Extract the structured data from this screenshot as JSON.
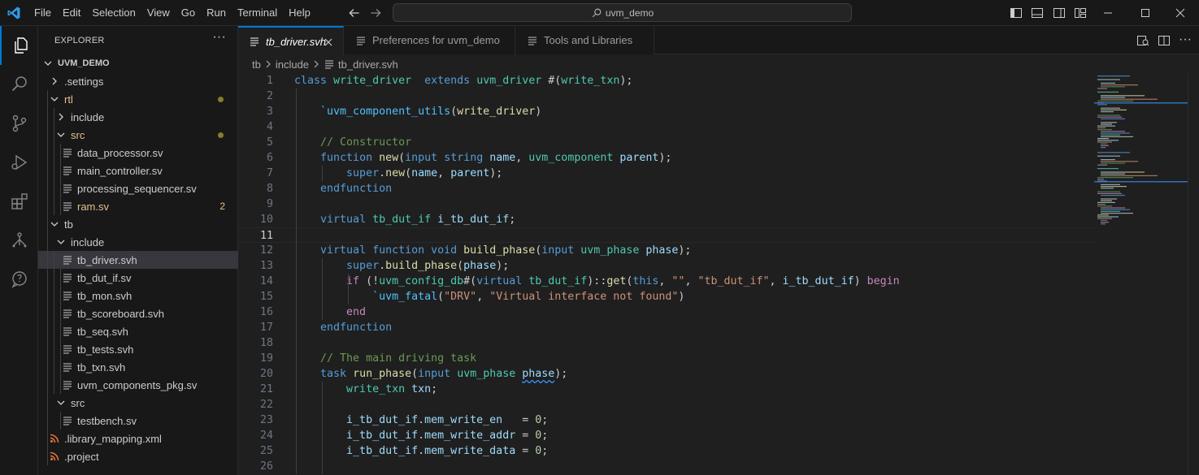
{
  "titlebar": {
    "menu": [
      "File",
      "Edit",
      "Selection",
      "View",
      "Go",
      "Run",
      "Terminal",
      "Help"
    ],
    "command_center": "uvm_demo"
  },
  "sidebar": {
    "header": "EXPLORER",
    "more": "···",
    "root": "UVM_DEMO",
    "items": [
      {
        "label": ".settings",
        "kind": "folder",
        "expanded": false,
        "depth": 1
      },
      {
        "label": "rtl",
        "kind": "folder",
        "expanded": true,
        "depth": 1,
        "modified": true
      },
      {
        "label": "include",
        "kind": "folder",
        "expanded": false,
        "depth": 2
      },
      {
        "label": "src",
        "kind": "folder",
        "expanded": true,
        "depth": 2,
        "modified": true
      },
      {
        "label": "data_processor.sv",
        "kind": "file",
        "depth": 3
      },
      {
        "label": "main_controller.sv",
        "kind": "file",
        "depth": 3
      },
      {
        "label": "processing_sequencer.sv",
        "kind": "file",
        "depth": 3
      },
      {
        "label": "ram.sv",
        "kind": "file",
        "depth": 3,
        "modified": true,
        "badge": "2"
      },
      {
        "label": "tb",
        "kind": "folder",
        "expanded": true,
        "depth": 1
      },
      {
        "label": "include",
        "kind": "folder",
        "expanded": true,
        "depth": 2
      },
      {
        "label": "tb_driver.svh",
        "kind": "file",
        "depth": 3,
        "selected": true
      },
      {
        "label": "tb_dut_if.sv",
        "kind": "file",
        "depth": 3
      },
      {
        "label": "tb_mon.svh",
        "kind": "file",
        "depth": 3
      },
      {
        "label": "tb_scoreboard.svh",
        "kind": "file",
        "depth": 3
      },
      {
        "label": "tb_seq.svh",
        "kind": "file",
        "depth": 3
      },
      {
        "label": "tb_tests.svh",
        "kind": "file",
        "depth": 3
      },
      {
        "label": "tb_txn.svh",
        "kind": "file",
        "depth": 3
      },
      {
        "label": "uvm_components_pkg.sv",
        "kind": "file",
        "depth": 3
      },
      {
        "label": "src",
        "kind": "folder",
        "expanded": true,
        "depth": 2
      },
      {
        "label": "testbench.sv",
        "kind": "file",
        "depth": 3
      },
      {
        "label": ".library_mapping.xml",
        "kind": "rss",
        "depth": 1
      },
      {
        "label": ".project",
        "kind": "rss",
        "depth": 1
      }
    ]
  },
  "tabs": [
    {
      "label": "tb_driver.svh",
      "active": true,
      "icon": "file-lines-icon"
    },
    {
      "label": "Preferences for uvm_demo",
      "active": false,
      "icon": "file-lines-icon"
    },
    {
      "label": "Tools and Libraries",
      "active": false,
      "icon": "file-lines-icon"
    }
  ],
  "breadcrumb": [
    "tb",
    "include",
    "tb_driver.svh"
  ],
  "editor": {
    "current_line": 11,
    "lines": [
      [
        [
          "kw",
          "class "
        ],
        [
          "ty",
          "write_driver"
        ],
        [
          "",
          "  "
        ],
        [
          "kw",
          "extends "
        ],
        [
          "ty",
          "uvm_driver"
        ],
        [
          "",
          " #("
        ],
        [
          "ty",
          "write_txn"
        ],
        [
          "",
          ");"
        ]
      ],
      [],
      [
        [
          "",
          "    "
        ],
        [
          "mac",
          "`uvm_component_utils"
        ],
        [
          "",
          "("
        ],
        [
          "fn",
          "write_driver"
        ],
        [
          "",
          ")"
        ]
      ],
      [],
      [
        [
          "",
          "    "
        ],
        [
          "cm",
          "// Constructor"
        ]
      ],
      [
        [
          "",
          "    "
        ],
        [
          "kw",
          "function "
        ],
        [
          "fn",
          "new"
        ],
        [
          "",
          "("
        ],
        [
          "kw",
          "input "
        ],
        [
          "kw",
          "string "
        ],
        [
          "var",
          "name"
        ],
        [
          "",
          ", "
        ],
        [
          "ty",
          "uvm_component "
        ],
        [
          "var",
          "parent"
        ],
        [
          "",
          ");"
        ]
      ],
      [
        [
          "",
          "        "
        ],
        [
          "kw",
          "super"
        ],
        [
          "",
          "."
        ],
        [
          "fn",
          "new"
        ],
        [
          "",
          "("
        ],
        [
          "var",
          "name"
        ],
        [
          "",
          ", "
        ],
        [
          "var",
          "parent"
        ],
        [
          "",
          ");"
        ]
      ],
      [
        [
          "",
          "    "
        ],
        [
          "kw",
          "endfunction"
        ]
      ],
      [],
      [
        [
          "",
          "    "
        ],
        [
          "kw",
          "virtual "
        ],
        [
          "ty",
          "tb_dut_if "
        ],
        [
          "var",
          "i_tb_dut_if"
        ],
        [
          "",
          ";"
        ]
      ],
      [],
      [
        [
          "",
          "    "
        ],
        [
          "kw",
          "virtual "
        ],
        [
          "kw",
          "function "
        ],
        [
          "kw",
          "void "
        ],
        [
          "fn",
          "build_phase"
        ],
        [
          "",
          "("
        ],
        [
          "kw",
          "input "
        ],
        [
          "ty",
          "uvm_phase "
        ],
        [
          "var",
          "phase"
        ],
        [
          "",
          ");"
        ]
      ],
      [
        [
          "",
          "        "
        ],
        [
          "kw",
          "super"
        ],
        [
          "",
          "."
        ],
        [
          "fn",
          "build_phase"
        ],
        [
          "",
          "("
        ],
        [
          "var",
          "phase"
        ],
        [
          "",
          ");"
        ]
      ],
      [
        [
          "",
          "        "
        ],
        [
          "ctl",
          "if "
        ],
        [
          "",
          "(!"
        ],
        [
          "ty",
          "uvm_config_db"
        ],
        [
          "",
          "#("
        ],
        [
          "kw",
          "virtual "
        ],
        [
          "ty",
          "tb_dut_if"
        ],
        [
          "",
          "):"
        ],
        [
          "",
          ":"
        ],
        [
          "fn",
          "get"
        ],
        [
          "",
          "("
        ],
        [
          "kw",
          "this"
        ],
        [
          "",
          ", "
        ],
        [
          "str",
          "\"\""
        ],
        [
          "",
          ", "
        ],
        [
          "str",
          "\"tb_dut_if\""
        ],
        [
          "",
          ", "
        ],
        [
          "var",
          "i_tb_dut_if"
        ],
        [
          "",
          ") "
        ],
        [
          "ctl",
          "begin"
        ]
      ],
      [
        [
          "",
          "            "
        ],
        [
          "mac",
          "`uvm_fatal"
        ],
        [
          "",
          "("
        ],
        [
          "str",
          "\"DRV\""
        ],
        [
          "",
          ", "
        ],
        [
          "str",
          "\"Virtual interface not found\""
        ],
        [
          "",
          ")"
        ]
      ],
      [
        [
          "",
          "        "
        ],
        [
          "ctl",
          "end"
        ]
      ],
      [
        [
          "",
          "    "
        ],
        [
          "kw",
          "endfunction"
        ]
      ],
      [],
      [
        [
          "",
          "    "
        ],
        [
          "cm",
          "// The main driving task"
        ]
      ],
      [
        [
          "",
          "    "
        ],
        [
          "kw",
          "task "
        ],
        [
          "fn",
          "run_phase"
        ],
        [
          "",
          "("
        ],
        [
          "kw",
          "input "
        ],
        [
          "ty",
          "uvm_phase "
        ],
        [
          "var squiggle",
          "phase"
        ],
        [
          "",
          ");"
        ]
      ],
      [
        [
          "",
          "        "
        ],
        [
          "ty",
          "write_txn "
        ],
        [
          "var",
          "txn"
        ],
        [
          "",
          ";"
        ]
      ],
      [],
      [
        [
          "",
          "        "
        ],
        [
          "var",
          "i_tb_dut_if"
        ],
        [
          "",
          "."
        ],
        [
          "var",
          "mem_write_en"
        ],
        [
          "",
          "   = "
        ],
        [
          "num",
          "0"
        ],
        [
          "",
          ";"
        ]
      ],
      [
        [
          "",
          "        "
        ],
        [
          "var",
          "i_tb_dut_if"
        ],
        [
          "",
          "."
        ],
        [
          "var",
          "mem_write_addr"
        ],
        [
          "",
          " = "
        ],
        [
          "num",
          "0"
        ],
        [
          "",
          ";"
        ]
      ],
      [
        [
          "",
          "        "
        ],
        [
          "var",
          "i_tb_dut_if"
        ],
        [
          "",
          "."
        ],
        [
          "var",
          "mem_write_data"
        ],
        [
          "",
          " = "
        ],
        [
          "num",
          "0"
        ],
        [
          "",
          ";"
        ]
      ],
      []
    ]
  },
  "colors": {
    "accent": "#0078d4",
    "editor_bg": "#1f1f1f",
    "sidebar_bg": "#181818",
    "modified": "#e2c08d"
  }
}
